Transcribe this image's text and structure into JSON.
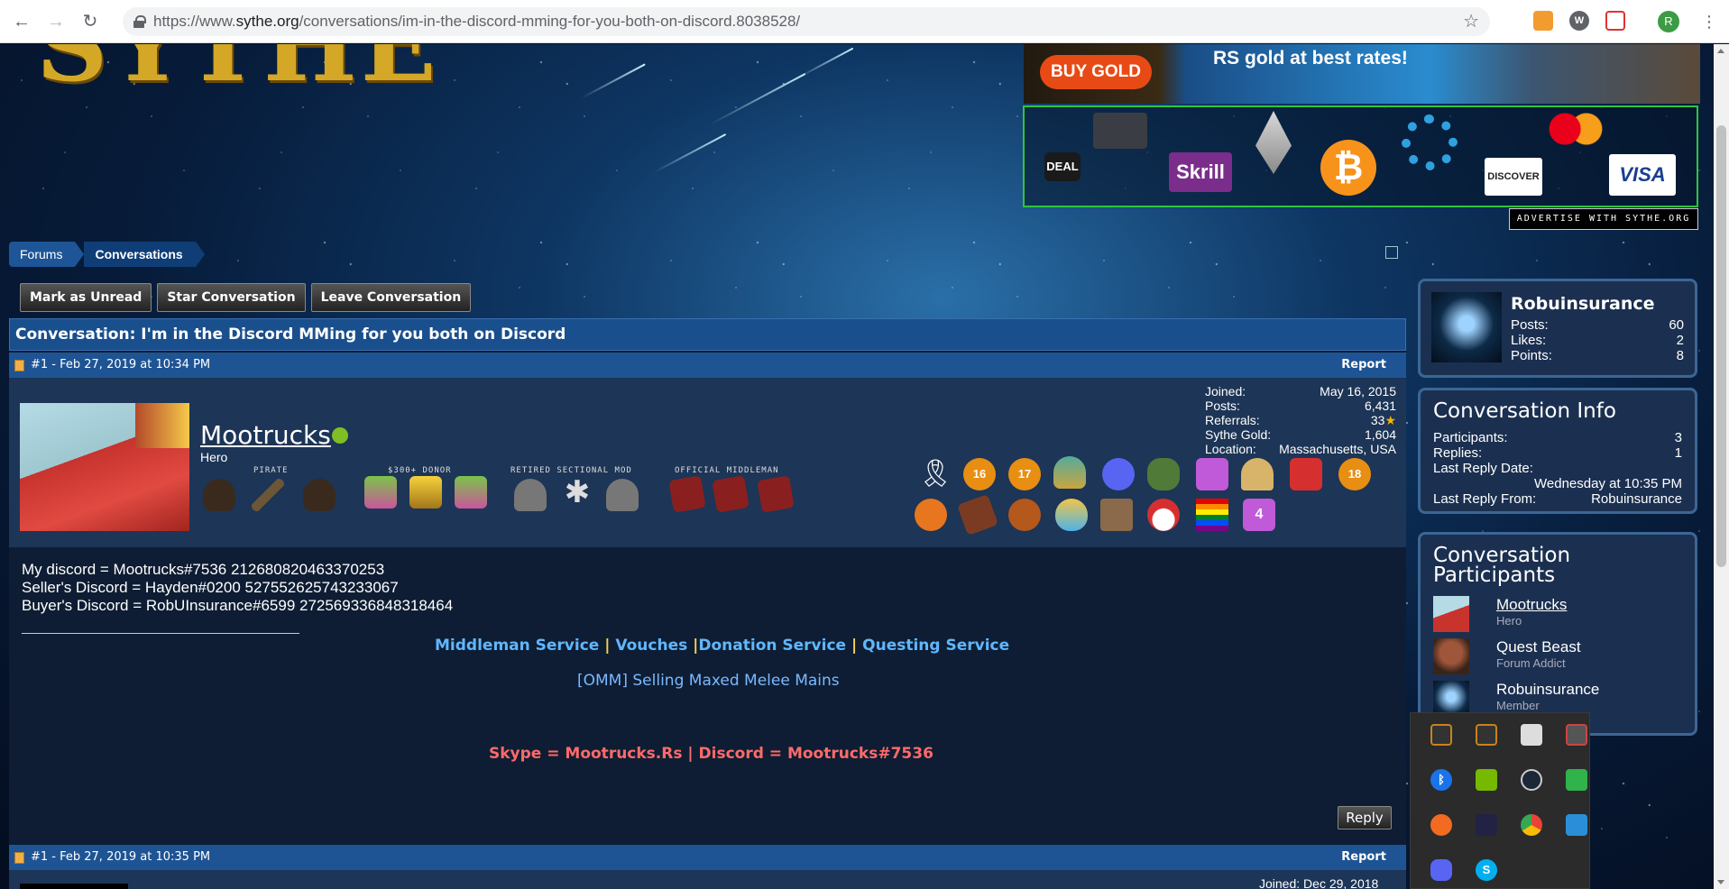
{
  "browser": {
    "url_prefix": "https://www.",
    "url_host": "sythe.org",
    "url_path": "/conversations/im-in-the-discord-mming-for-you-both-on-discord.8038528/",
    "back": "←",
    "forward": "→",
    "reload": "↻",
    "bookmark_star": "☆",
    "profile_initial": "R",
    "menu": "⋮"
  },
  "site": {
    "logo_text": "SYTHE",
    "ads": {
      "buy_gold": "BUY GOLD",
      "rs_gold": "RS gold at best rates!",
      "payments": [
        "DEAL",
        "Skrill",
        "DISCOVER",
        "VISA"
      ],
      "advertise": "ADVERTISE WITH SYTHE.ORG"
    }
  },
  "breadcrumb": [
    "Forums",
    "Conversations"
  ],
  "actions": [
    "Mark as Unread",
    "Star Conversation",
    "Leave Conversation"
  ],
  "conversation": {
    "title": "Conversation: I'm in the Discord MMing for you both on Discord",
    "posts": [
      {
        "header": "#1 - Feb 27, 2019 at 10:34 PM",
        "report": "Report",
        "username": "Mootrucks",
        "user_title": "Hero",
        "rank_labels": [
          "PIRATE",
          "$300+ DONOR",
          "RETIRED SECTIONAL MOD",
          "OFFICIAL MIDDLEMAN"
        ],
        "stats": [
          {
            "k": "Joined:",
            "v": "May 16, 2015"
          },
          {
            "k": "Posts:",
            "v": "6,431"
          },
          {
            "k": "Referrals:",
            "v": "33"
          },
          {
            "k": "Sythe Gold:",
            "v": "1,604"
          },
          {
            "k": "Location:",
            "v": "Massachusetts, USA"
          }
        ],
        "badge_numbers": [
          "16",
          "17",
          "18",
          "18",
          "4",
          "18"
        ],
        "body": [
          "My discord = Mootrucks#7536 212680820463370253",
          "Seller's Discord = Hayden#0200 527552625743233067",
          "Buyer's Discord = RobUInsurance#6599 272569336848318464"
        ],
        "signature": {
          "links": [
            "Middleman Service",
            "Vouches",
            "Donation Service",
            "Questing Service"
          ],
          "separator": "|",
          "thread": "[OMM] Selling Maxed Melee Mains",
          "contact": "Skype = Mootrucks.Rs | Discord = Mootrucks#7536"
        },
        "reply": "Reply"
      },
      {
        "header": "#1 - Feb 27, 2019 at 10:35 PM",
        "report": "Report",
        "joined_label": "Joined:",
        "joined_value": "Dec 29, 2018"
      }
    ]
  },
  "sidebar": {
    "user": {
      "name": "Robuinsurance",
      "stats": [
        {
          "k": "Posts:",
          "v": "60"
        },
        {
          "k": "Likes:",
          "v": "2"
        },
        {
          "k": "Points:",
          "v": "8"
        }
      ]
    },
    "info": {
      "title": "Conversation Info",
      "participants_label": "Participants:",
      "participants": "3",
      "replies_label": "Replies:",
      "replies": "1",
      "last_reply_date_label": "Last Reply Date:",
      "last_reply_date": "Wednesday at 10:35 PM",
      "last_reply_from_label": "Last Reply From:",
      "last_reply_from": "Robuinsurance"
    },
    "participants": {
      "title": "Conversation Participants",
      "list": [
        {
          "name": "Mootrucks",
          "title": "Hero"
        },
        {
          "name": "Quest Beast",
          "title": "Forum Addict"
        },
        {
          "name": "Robuinsurance",
          "title": "Member"
        }
      ]
    }
  },
  "colors": {
    "header_blue": "#1a4f8d",
    "link_blue": "#5fb7ff",
    "online_green": "#7fbf24",
    "contact_red": "#ff6a6a"
  }
}
